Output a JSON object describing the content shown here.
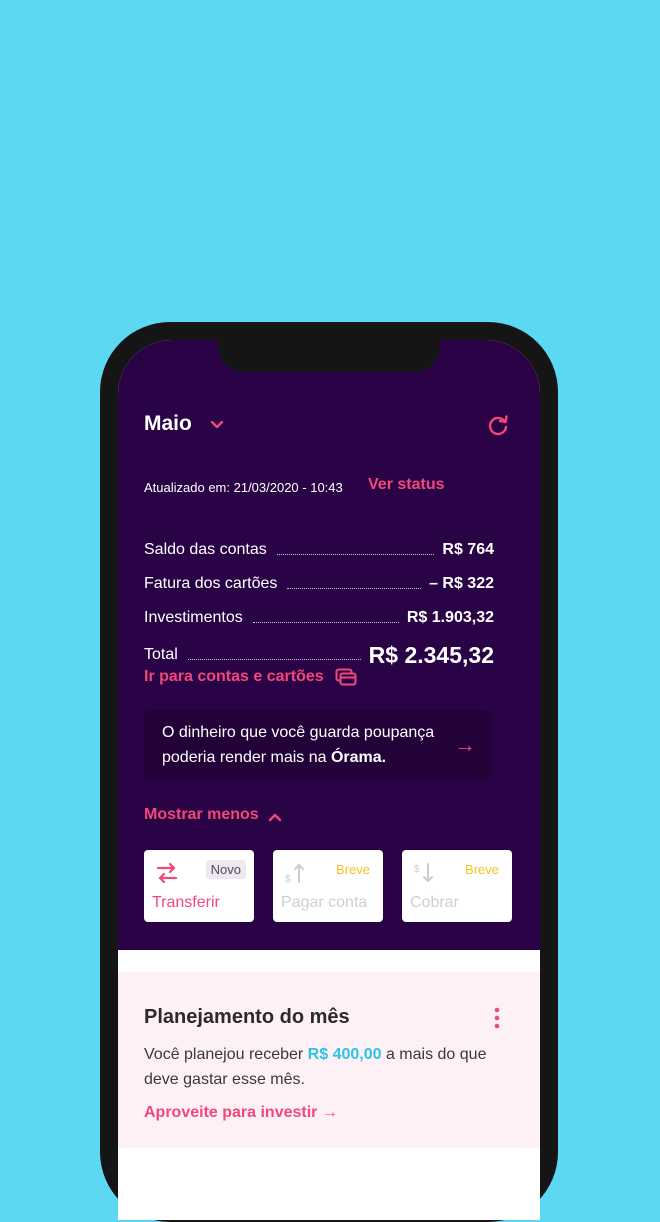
{
  "header": {
    "month": "Maio",
    "updated_label": "Atualizado em: 21/03/2020 - 10:43",
    "status_link": "Ver status"
  },
  "summary": {
    "rows": [
      {
        "label": "Saldo das contas",
        "value": "R$ 764"
      },
      {
        "label": "Fatura dos cartões",
        "value": "– R$ 322"
      },
      {
        "label": "Investimentos",
        "value": "R$ 1.903,32"
      }
    ],
    "total_label": "Total",
    "total_value": "R$ 2.345,32"
  },
  "accounts_link": "Ir para contas e cartões",
  "promo": {
    "text_before": "O dinheiro que você guarda poupança poderia render mais na ",
    "brand": "Órama.",
    "arrow": "→"
  },
  "toggle_label": "Mostrar menos",
  "actions": [
    {
      "label": "Transferir",
      "badge": "Novo",
      "icon": "transfer-icon"
    },
    {
      "label": "Pagar conta",
      "badge": "Breve",
      "icon": "pay-bill-icon"
    },
    {
      "label": "Cobrar",
      "badge": "Breve",
      "icon": "charge-icon"
    }
  ],
  "planning": {
    "title": "Planejamento do mês",
    "text_before": "Você planejou receber ",
    "highlight": "R$ 400,00",
    "text_after": " a mais do que deve gastar esse mês.",
    "link": "Aproveite para investir →"
  },
  "colors": {
    "background": "#5cd8f2",
    "primary": "#2a0347",
    "accent": "#f2477a",
    "highlight": "#2bc4e7",
    "badge_breve": "#f3c229"
  }
}
